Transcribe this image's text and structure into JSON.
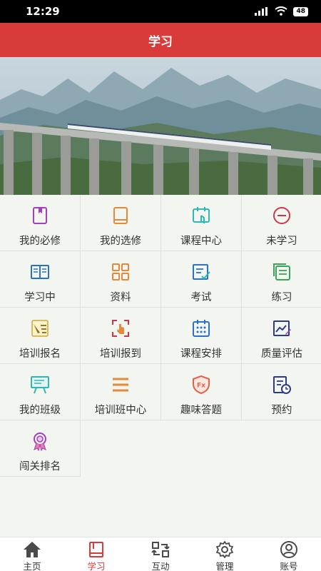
{
  "status": {
    "time": "12:29",
    "battery": "48"
  },
  "header": {
    "title": "学习"
  },
  "menu": [
    {
      "label": "我的必修",
      "icon": "required-book-icon"
    },
    {
      "label": "我的选修",
      "icon": "elective-book-icon"
    },
    {
      "label": "课程中心",
      "icon": "course-center-icon"
    },
    {
      "label": "未学习",
      "icon": "minus-circle-icon"
    },
    {
      "label": "学习中",
      "icon": "open-book-icon"
    },
    {
      "label": "资料",
      "icon": "grid-materials-icon"
    },
    {
      "label": "考试",
      "icon": "exam-checklist-icon"
    },
    {
      "label": "练习",
      "icon": "practice-pages-icon"
    },
    {
      "label": "培训报名",
      "icon": "signup-pen-icon"
    },
    {
      "label": "培训报到",
      "icon": "checkin-hand-icon"
    },
    {
      "label": "课程安排",
      "icon": "calendar-icon"
    },
    {
      "label": "质量评估",
      "icon": "evaluation-chart-icon"
    },
    {
      "label": "我的班级",
      "icon": "class-board-icon"
    },
    {
      "label": "培训班中心",
      "icon": "menu-lines-icon"
    },
    {
      "label": "趣味答题",
      "icon": "quiz-shield-icon"
    },
    {
      "label": "预约",
      "icon": "appointment-clock-icon"
    },
    {
      "label": "闯关排名",
      "icon": "ranking-medal-icon"
    }
  ],
  "tabs": [
    {
      "label": "主页",
      "icon": "home-icon"
    },
    {
      "label": "学习",
      "icon": "study-book-icon"
    },
    {
      "label": "互动",
      "icon": "interaction-refresh-icon"
    },
    {
      "label": "管理",
      "icon": "gear-icon"
    },
    {
      "label": "账号",
      "icon": "user-icon"
    }
  ],
  "colors": {
    "header": "#d93a3a",
    "active_tab": "#d93a3a",
    "purple": "#a23fbe",
    "orange": "#e4893a",
    "teal": "#2fb7b4",
    "red": "#c9374a",
    "blue": "#2a71c9",
    "green": "#39a45a"
  }
}
